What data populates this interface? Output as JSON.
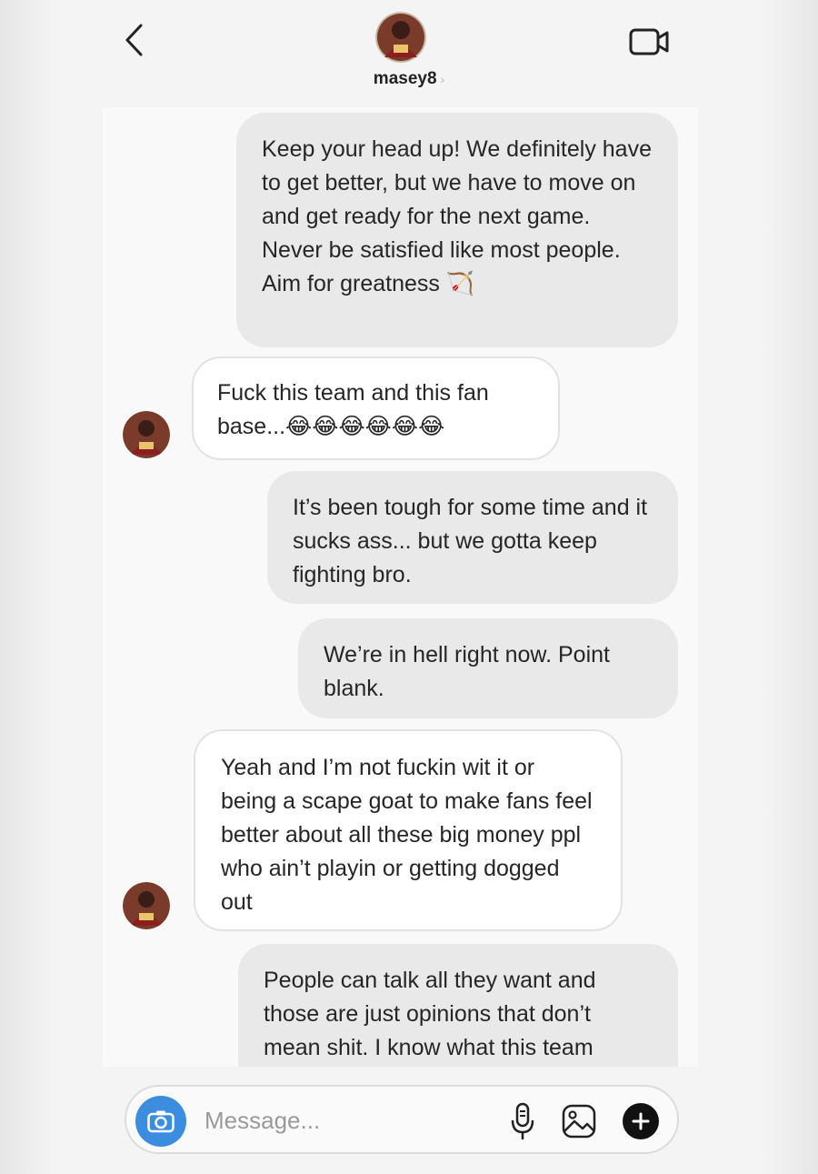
{
  "header": {
    "username": "masey8",
    "chevron": "›"
  },
  "icons": {
    "back": "chevron-left-icon",
    "video": "video-camera-icon",
    "camera": "camera-icon",
    "mic": "microphone-icon",
    "gallery": "image-icon",
    "plus": "plus-icon"
  },
  "messages": [
    {
      "direction": "outgoing",
      "text": "Keep your head up! We definitely have to get better, but we have to move on and get ready for the next game. Never be satisfied like most people. Aim for greatness 🏹"
    },
    {
      "direction": "incoming",
      "text": "Fuck this team and this fan base...😂😂😂😂😂😂"
    },
    {
      "direction": "outgoing",
      "text": "It’s been tough for some time and it sucks ass... but we gotta keep fighting bro."
    },
    {
      "direction": "outgoing",
      "text": "We’re in hell right now. Point blank."
    },
    {
      "direction": "incoming",
      "text": "Yeah and I’m not fuckin wit it or being a scape goat to make fans feel better about all these big money ppl who ain’t playin or getting dogged out"
    },
    {
      "direction": "outgoing",
      "text": "People can talk all they want and those are just opinions that don’t mean shit. I know what this team"
    }
  ],
  "composer": {
    "placeholder": "Message..."
  },
  "colors": {
    "outgoing_bubble": "#e9e9e9",
    "incoming_bubble": "#ffffff",
    "camera_button": "#3b8de0"
  }
}
